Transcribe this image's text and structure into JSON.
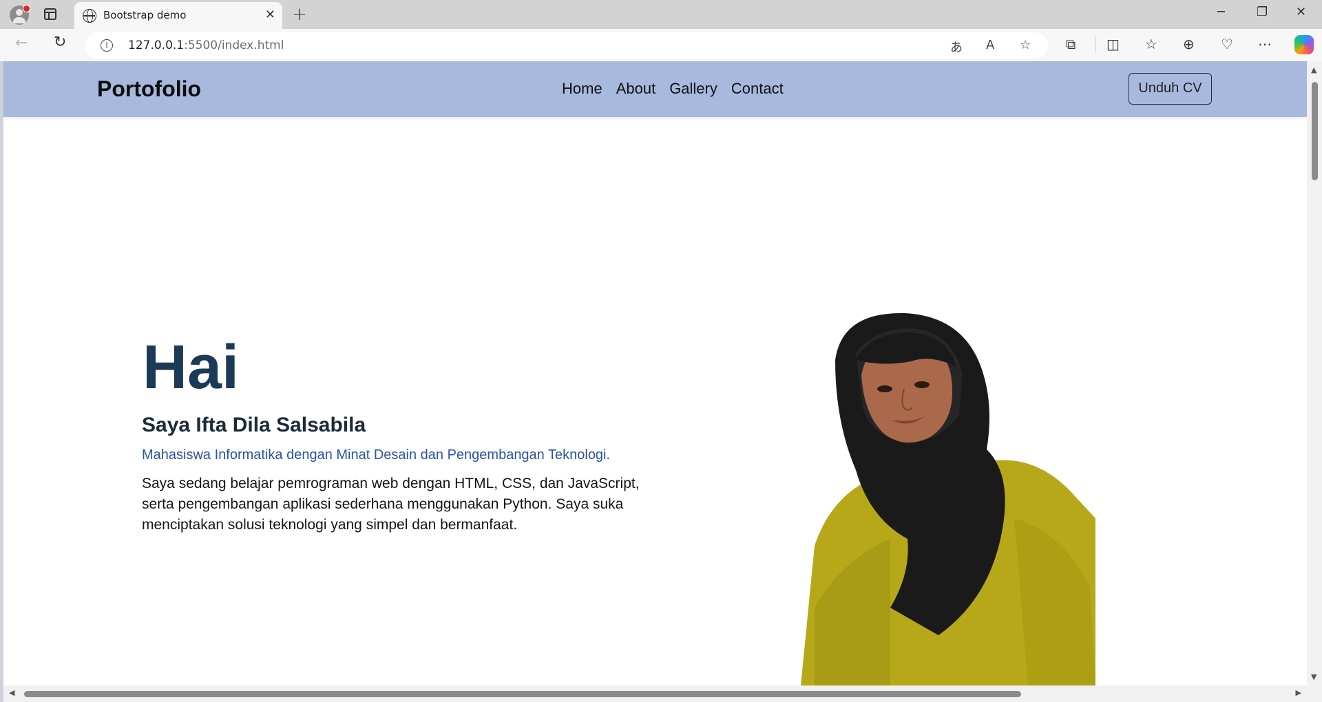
{
  "browser": {
    "tab_title": "Bootstrap demo",
    "url_host": "127.0.0.1",
    "url_rest": ":5500/index.html"
  },
  "navbar": {
    "brand": "Portofolio",
    "links": [
      "Home",
      "About",
      "Gallery",
      "Contact"
    ],
    "cv_button": "Unduh CV"
  },
  "hero": {
    "greeting": "Hai",
    "name": "Saya Ifta Dila Salsabila",
    "subtitle": "Mahasiswa Informatika dengan Minat Desain dan Pengembangan Teknologi.",
    "body": "Saya sedang belajar pemrograman web dengan HTML, CSS, dan JavaScript, serta pengembangan aplikasi sederhana menggunakan Python. Saya suka menciptakan solusi teknologi yang simpel dan bermanfaat."
  },
  "colors": {
    "navbar_bg": "#a8b9de",
    "greeting": "#1b3a58",
    "subtitle": "#2a54a0",
    "shirt": "#b6a818",
    "hijab": "#1a1a1a"
  },
  "icons": {
    "tab": "globe-icon",
    "toolbar": [
      "back-icon",
      "reload-icon",
      "info-icon",
      "translate-icon",
      "read-aloud-icon",
      "favorite-star-icon",
      "extensions-icon",
      "split-screen-icon",
      "favorites-icon",
      "collections-icon",
      "browser-essentials-icon",
      "more-icon",
      "copilot-icon"
    ]
  }
}
